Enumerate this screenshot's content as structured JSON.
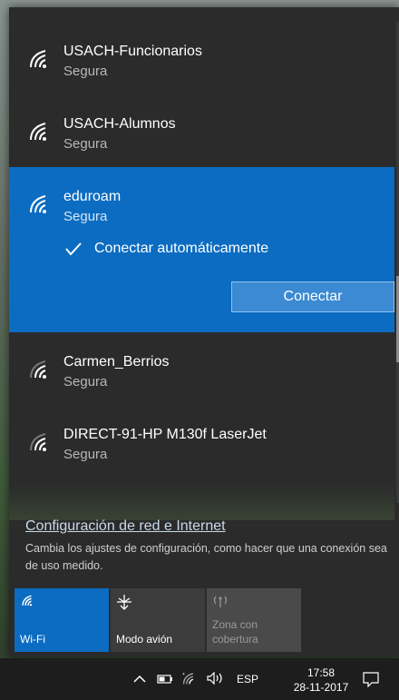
{
  "networks": [
    {
      "name": "USACH-Funcionarios",
      "status": "Segura"
    },
    {
      "name": "USACH-Alumnos",
      "status": "Segura"
    },
    {
      "name": "eduroam",
      "status": "Segura",
      "auto_connect_label": "Conectar automáticamente",
      "connect_button": "Conectar"
    },
    {
      "name": "Carmen_Berrios",
      "status": "Segura"
    },
    {
      "name": "DIRECT-91-HP M130f LaserJet",
      "status": "Segura"
    }
  ],
  "settings": {
    "link": "Configuración de red e Internet",
    "description": "Cambia los ajustes de configuración, como hacer que una conexión sea de uso medido."
  },
  "quick_actions": [
    {
      "label": "Wi-Fi",
      "icon": "wifi-icon",
      "state": "on"
    },
    {
      "label": "Modo avión",
      "icon": "airplane-icon",
      "state": "off"
    },
    {
      "label": "Zona con cobertura",
      "icon": "hotspot-icon",
      "state": "disabled"
    }
  ],
  "taskbar": {
    "language": "ESP",
    "time": "17:58",
    "date": "28-11-2017"
  },
  "colors": {
    "accent": "#0c6cc1",
    "flyout_bg": "#2b2b2b",
    "taskbar_bg": "#1d1d1d"
  }
}
